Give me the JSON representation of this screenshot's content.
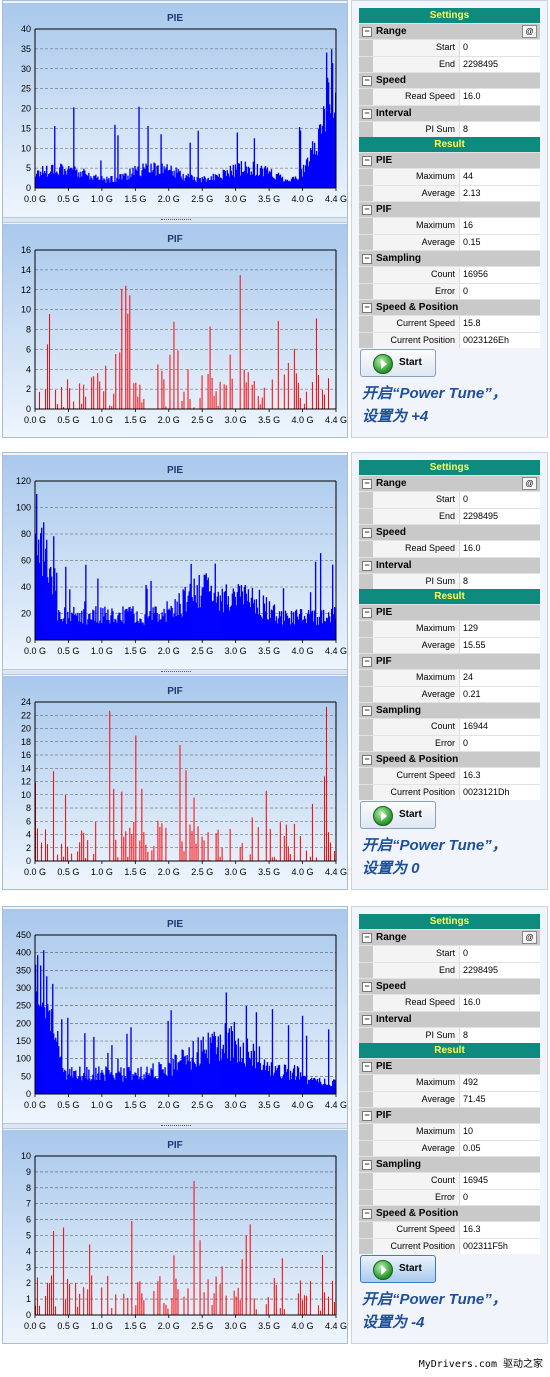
{
  "panels": [
    {
      "pie_chart": {
        "title": "PIE",
        "ymax": 40,
        "ystep": 5,
        "color": "#0000ff",
        "profile": "edge_rise",
        "x_ticks": [
          "0.0 G",
          "0.5 G",
          "1.0 G",
          "1.5 G",
          "2.0 G",
          "2.5 G",
          "3.0 G",
          "3.5 G",
          "4.0 G",
          "4.4 G"
        ]
      },
      "pif_chart": {
        "title": "PIF",
        "ymax": 16,
        "ystep": 2,
        "color": "#ff0000",
        "x_ticks": [
          "0.0 G",
          "0.5 G",
          "1.0 G",
          "1.5 G",
          "2.0 G",
          "2.5 G",
          "3.0 G",
          "3.5 G",
          "4.0 G",
          "4.4 G"
        ]
      },
      "settings": {
        "title": "Settings",
        "range_label": "Range",
        "start_label": "Start",
        "start_value": "0",
        "end_label": "End",
        "end_value": "2298495",
        "speed_label": "Speed",
        "read_speed_label": "Read Speed",
        "read_speed_value": "16.0",
        "interval_label": "Interval",
        "pi_sum_label": "PI Sum",
        "pi_sum_value": "8"
      },
      "result": {
        "title": "Result",
        "pie_label": "PIE",
        "pie_max_label": "Maximum",
        "pie_max": "44",
        "pie_avg_label": "Average",
        "pie_avg": "2.13",
        "pif_label": "PIF",
        "pif_max_label": "Maximum",
        "pif_max": "16",
        "pif_avg_label": "Average",
        "pif_avg": "0.15",
        "sampling_label": "Sampling",
        "count_label": "Count",
        "count": "16956",
        "error_label": "Error",
        "error": "0",
        "sp_label": "Speed & Position",
        "cur_speed_label": "Current Speed",
        "cur_speed": "15.8",
        "cur_pos_label": "Current Position",
        "cur_pos": "0023126Eh"
      },
      "start_label": "Start",
      "note_line1": "开启“Power Tune”，",
      "note_line2": "设置为 +4"
    },
    {
      "pie_chart": {
        "title": "PIE",
        "ymax": 120,
        "ystep": 20,
        "color": "#0000ff",
        "profile": "hump_mid",
        "x_ticks": [
          "0.0 G",
          "0.5 G",
          "1.0 G",
          "1.5 G",
          "2.0 G",
          "2.5 G",
          "3.0 G",
          "3.5 G",
          "4.0 G",
          "4.4 G"
        ]
      },
      "pif_chart": {
        "title": "PIF",
        "ymax": 24,
        "ystep": 2,
        "color": "#ff0000",
        "x_ticks": [
          "0.0 G",
          "0.5 G",
          "1.0 G",
          "1.5 G",
          "2.0 G",
          "2.5 G",
          "3.0 G",
          "3.5 G",
          "4.0 G",
          "4.4 G"
        ]
      },
      "settings": {
        "title": "Settings",
        "range_label": "Range",
        "start_label": "Start",
        "start_value": "0",
        "end_label": "End",
        "end_value": "2298495",
        "speed_label": "Speed",
        "read_speed_label": "Read Speed",
        "read_speed_value": "16.0",
        "interval_label": "Interval",
        "pi_sum_label": "PI Sum",
        "pi_sum_value": "8"
      },
      "result": {
        "title": "Result",
        "pie_label": "PIE",
        "pie_max_label": "Maximum",
        "pie_max": "129",
        "pie_avg_label": "Average",
        "pie_avg": "15.55",
        "pif_label": "PIF",
        "pif_max_label": "Maximum",
        "pif_max": "24",
        "pif_avg_label": "Average",
        "pif_avg": "0.21",
        "sampling_label": "Sampling",
        "count_label": "Count",
        "count": "16944",
        "error_label": "Error",
        "error": "0",
        "sp_label": "Speed & Position",
        "cur_speed_label": "Current Speed",
        "cur_speed": "16.3",
        "cur_pos_label": "Current Position",
        "cur_pos": "0023121Dh"
      },
      "start_label": "Start",
      "note_line1": "开启“Power Tune”，",
      "note_line2": "设置为 0"
    },
    {
      "pie_chart": {
        "title": "PIE",
        "ymax": 450,
        "ystep": 50,
        "color": "#0000ff",
        "profile": "hump_late",
        "x_ticks": [
          "0.0 G",
          "0.5 G",
          "1.0 G",
          "1.5 G",
          "2.0 G",
          "2.5 G",
          "3.0 G",
          "3.5 G",
          "4.0 G",
          "4.4 G"
        ]
      },
      "pif_chart": {
        "title": "PIF",
        "ymax": 10,
        "ystep": 1,
        "color": "#ff0000",
        "x_ticks": [
          "0.0 G",
          "0.5 G",
          "1.0 G",
          "1.5 G",
          "2.0 G",
          "2.5 G",
          "3.0 G",
          "3.5 G",
          "4.0 G",
          "4.4 G"
        ]
      },
      "settings": {
        "title": "Settings",
        "range_label": "Range",
        "start_label": "Start",
        "start_value": "0",
        "end_label": "End",
        "end_value": "2298495",
        "speed_label": "Speed",
        "read_speed_label": "Read Speed",
        "read_speed_value": "16.0",
        "interval_label": "Interval",
        "pi_sum_label": "PI Sum",
        "pi_sum_value": "8"
      },
      "result": {
        "title": "Result",
        "pie_label": "PIE",
        "pie_max_label": "Maximum",
        "pie_max": "492",
        "pie_avg_label": "Average",
        "pie_avg": "71.45",
        "pif_label": "PIF",
        "pif_max_label": "Maximum",
        "pif_max": "10",
        "pif_avg_label": "Average",
        "pif_avg": "0.05",
        "sampling_label": "Sampling",
        "count_label": "Count",
        "count": "16945",
        "error_label": "Error",
        "error": "0",
        "sp_label": "Speed & Position",
        "cur_speed_label": "Current Speed",
        "cur_speed": "16.3",
        "cur_pos_label": "Current Position",
        "cur_pos": "002311F5h"
      },
      "start_label": "Start",
      "note_line1": "开启“Power Tune”，",
      "note_line2": "设置为 -4"
    }
  ],
  "watermark": "MyDrivers.com 驱动之家"
}
